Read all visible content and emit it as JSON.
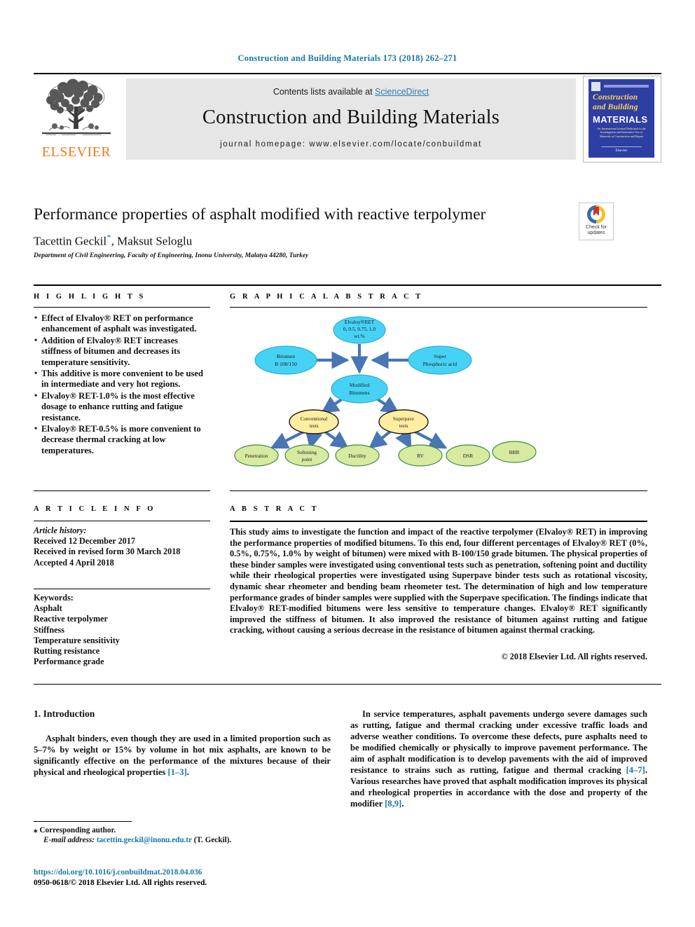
{
  "running_head": "Construction and Building Materials 173 (2018) 262–271",
  "masthead": {
    "contents_prefix": "Contents lists available at ",
    "sciencedirect": "ScienceDirect",
    "journal_title": "Construction and Building Materials",
    "homepage": "journal homepage: www.elsevier.com/locate/conbuildmat",
    "publisher": "ELSEVIER",
    "cover": {
      "line1": "Construction",
      "line2": "and Building",
      "line3": "MATERIALS",
      "blurb": "An International Journal Dedicated to the Investigation and Innovative Use of Materials in Construction and Repair",
      "foot": "Elsevier"
    }
  },
  "article": {
    "title": "Performance properties of asphalt modified with reactive terpolymer",
    "authors": "Tacettin Geckil",
    "authors_star": "*",
    "authors_rest": ", Maksut Seloglu",
    "affiliation": "Department of Civil Engineering, Faculty of Engineering, Inonu University, Malatya 44280, Turkey",
    "crossmark_label": "Check for updates"
  },
  "sections": {
    "highlights": "H I G H L I G H T S",
    "graphical_abstract": "G R A P H I C A L   A B S T R A C T",
    "article_info": "A R T I C L E   I N F O",
    "abstract": "A B S T R A C T"
  },
  "highlights": [
    "Effect of Elvaloy® RET on performance enhancement of asphalt was investigated.",
    "Addition of Elvaloy® RET increases stiffness of bitumen and decreases its temperature sensitivity.",
    "This additive is more convenient to be used in intermediate and very hot regions.",
    "Elvaloy® RET-1.0% is the most effective dosage to enhance rutting and fatigue resistance.",
    "Elvaloy® RET-0.5% is more convenient to decrease thermal cracking at low temperatures."
  ],
  "article_history": {
    "label": "Article history:",
    "lines": [
      "Received 12 December 2017",
      "Received in revised form 30 March 2018",
      "Accepted 4 April 2018"
    ]
  },
  "keywords": {
    "label": "Keywords:",
    "items": [
      "Asphalt",
      "Reactive terpolymer",
      "Stiffness",
      "Temperature sensitivity",
      "Rutting resistance",
      "Performance grade"
    ]
  },
  "graphical_abstract_diagram": {
    "nodes": [
      {
        "id": "elvaloy",
        "label": "Elvaloy®RET\n0, 0.5, 0.75, 1.0\nwt.%",
        "color": "#46d2f5"
      },
      {
        "id": "bitumen",
        "label": "Bitumen\nB 100/150",
        "color": "#46d2f5"
      },
      {
        "id": "spa",
        "label": "Super\nPhosphoric acid",
        "color": "#46d2f5"
      },
      {
        "id": "modified",
        "label": "Modified\nBitumens",
        "color": "#46d2f5"
      },
      {
        "id": "conventional",
        "label": "Conventional\ntests",
        "color": "#ffeea0"
      },
      {
        "id": "superpave",
        "label": "Superpave\ntests",
        "color": "#ffeea0"
      },
      {
        "id": "penetration",
        "label": "Penetration",
        "color": "#d6eaa0"
      },
      {
        "id": "softening",
        "label": "Softening\npoint",
        "color": "#d6eaa0"
      },
      {
        "id": "ductility",
        "label": "Ductility",
        "color": "#d6eaa0"
      },
      {
        "id": "rv",
        "label": "RV",
        "color": "#d6eaa0"
      },
      {
        "id": "dsr",
        "label": "DSR",
        "color": "#d6eaa0"
      },
      {
        "id": "bbr",
        "label": "BBR",
        "color": "#d6eaa0"
      }
    ],
    "arrow_color": "#4876b4"
  },
  "abstract_text": "This study aims to investigate the function and impact of the reactive terpolymer (Elvaloy® RET) in improving the performance properties of modified bitumens. To this end, four different percentages of Elvaloy® RET (0%, 0.5%, 0.75%, 1.0% by weight of bitumen) were mixed with B-100/150 grade bitumen. The physical properties of these binder samples were investigated using conventional tests such as penetration, softening point and ductility while their rheological properties were investigated using Superpave binder tests such as rotational viscosity, dynamic shear rheometer and bending beam rheometer test. The determination of high and low temperature performance grades of binder samples were supplied with the Superpave specification. The findings indicate that Elvaloy® RET-modified bitumens were less sensitive to temperature changes. Elvaloy® RET significantly improved the stiffness of bitumen. It also improved the resistance of bitumen against rutting and fatigue cracking, without causing a serious decrease in the resistance of bitumen against thermal cracking.",
  "copyright": "© 2018 Elsevier Ltd. All rights reserved.",
  "body": {
    "intro_heading": "1. Introduction",
    "left_paragraph_a": "Asphalt binders, even though they are used in a limited proportion such as 5–7% by weight or 15% by volume in hot mix asphalts, are known to be significantly effective on the performance of the mixtures because of their physical and rheological properties ",
    "left_ref_a": "[1–3]",
    "left_paragraph_a_end": ".",
    "right_paragraph_a": "In service temperatures, asphalt pavements undergo severe damages such as rutting, fatigue and thermal cracking under excessive traffic loads and adverse weather conditions. To overcome these defects, pure asphalts need to be modified chemically or physically to improve pavement performance. The aim of asphalt modification is to develop pavements with the aid of improved resistance to strains such as rutting, fatigue and thermal cracking ",
    "right_ref_a": "[4–7]",
    "right_paragraph_b": ". Various researches have proved that asphalt modification improves its physical and rheological properties in accordance with the dose and property of the modifier ",
    "right_ref_b": "[8,9]",
    "right_paragraph_b_end": "."
  },
  "footer": {
    "corresponding_marker": "⁎",
    "corresponding": "Corresponding author.",
    "email_label": "E-mail address:",
    "email": "tacettin.geckil@inonu.edu.tr",
    "email_suffix": "(T. Geckil).",
    "doi": "https://doi.org/10.1016/j.conbuildmat.2018.04.036",
    "issn_line": "0950-0618/© 2018 Elsevier Ltd. All rights reserved."
  }
}
